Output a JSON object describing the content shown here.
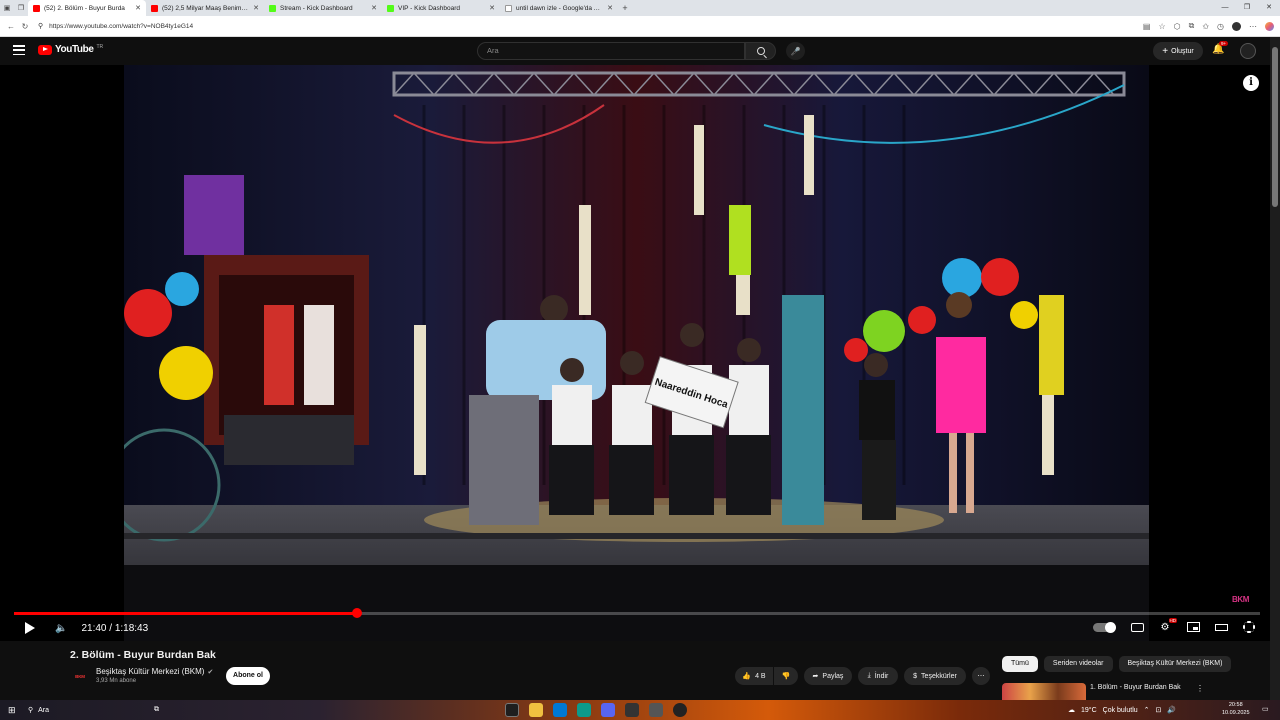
{
  "browser": {
    "tabs": [
      {
        "title": "(52) 2. Bölüm - Buyur Burda",
        "favicon_color": "#ff0000",
        "active": true
      },
      {
        "title": "(52) 2,5 Milyar Maaş Benim Aracım",
        "favicon_color": "#ff0000",
        "active": false
      },
      {
        "title": "Stream - Kick Dashboard",
        "favicon_color": "#53fc18",
        "active": false
      },
      {
        "title": "VIP - Kick Dashboard",
        "favicon_color": "#53fc18",
        "active": false
      },
      {
        "title": "until dawn izle - Google'da Ara",
        "favicon_color": "#ffffff",
        "active": false
      }
    ],
    "url": "https://www.youtube.com/watch?v=NOB4ty1eG14"
  },
  "header": {
    "logo_text": "YouTube",
    "logo_region": "TR",
    "search_placeholder": "Ara",
    "create_label": "Oluştur",
    "notification_count": "9+"
  },
  "player": {
    "current_time": "21:40",
    "duration": "1:18:43",
    "time_display": "21:40 / 1:18:43",
    "progress_fraction": 0.275,
    "watermark": "BKM",
    "hd_badge": "HD",
    "sign_text": "Naareddin Hoca"
  },
  "video": {
    "title": "2. Bölüm - Buyur Burdan Bak",
    "channel_name": "Beşiktaş Kültür Merkezi (BKM)",
    "channel_avatar_text": "BKM",
    "subscribers": "3,93 Mn abone",
    "subscribe_label": "Abone ol",
    "likes": "4 B",
    "share_label": "Paylaş",
    "download_label": "İndir",
    "thanks_label": "Teşekkürler"
  },
  "sidebar": {
    "chips": [
      "Tümü",
      "Seriden videolar",
      "Beşiktaş Kültür Merkezi (BKM)"
    ],
    "first_rec_title": "1. Bölüm - Buyur Burdan Bak"
  },
  "taskbar": {
    "search_label": "Ara",
    "temperature": "19°C",
    "weather": "Çok bulutlu",
    "time": "20:58",
    "date": "10.09.2025"
  }
}
